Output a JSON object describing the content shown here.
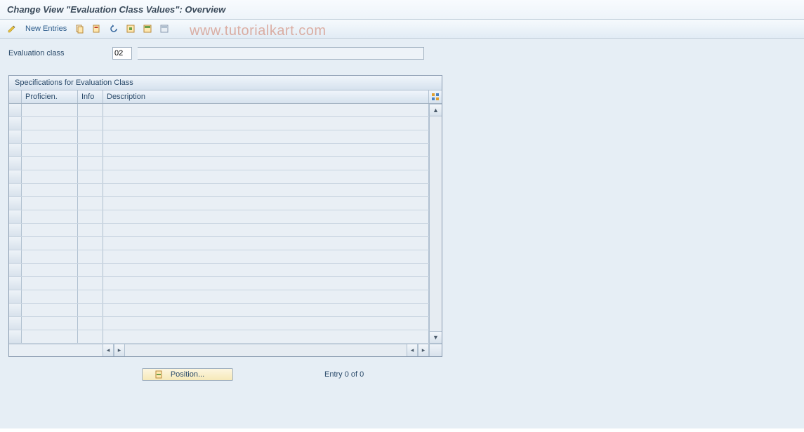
{
  "title": "Change View \"Evaluation Class Values\": Overview",
  "toolbar": {
    "new_entries_label": "New Entries",
    "icons": {
      "edit": "edit-pencil-icon",
      "copy": "copy-icon",
      "delete": "delete-icon",
      "undo": "undo-icon",
      "select_all": "select-all-icon",
      "select_block": "select-block-icon",
      "deselect": "deselect-icon"
    }
  },
  "watermark": "www.tutorialkart.com",
  "form": {
    "evaluation_class_label": "Evaluation class",
    "evaluation_class_value": "02",
    "evaluation_class_desc": ""
  },
  "table": {
    "title": "Specifications for Evaluation Class",
    "columns": {
      "proficiency": "Proficien.",
      "info": "Info",
      "description": "Description"
    },
    "rows": [
      {
        "proficiency": "",
        "info": "",
        "description": ""
      },
      {
        "proficiency": "",
        "info": "",
        "description": ""
      },
      {
        "proficiency": "",
        "info": "",
        "description": ""
      },
      {
        "proficiency": "",
        "info": "",
        "description": ""
      },
      {
        "proficiency": "",
        "info": "",
        "description": ""
      },
      {
        "proficiency": "",
        "info": "",
        "description": ""
      },
      {
        "proficiency": "",
        "info": "",
        "description": ""
      },
      {
        "proficiency": "",
        "info": "",
        "description": ""
      },
      {
        "proficiency": "",
        "info": "",
        "description": ""
      },
      {
        "proficiency": "",
        "info": "",
        "description": ""
      },
      {
        "proficiency": "",
        "info": "",
        "description": ""
      },
      {
        "proficiency": "",
        "info": "",
        "description": ""
      },
      {
        "proficiency": "",
        "info": "",
        "description": ""
      },
      {
        "proficiency": "",
        "info": "",
        "description": ""
      },
      {
        "proficiency": "",
        "info": "",
        "description": ""
      },
      {
        "proficiency": "",
        "info": "",
        "description": ""
      },
      {
        "proficiency": "",
        "info": "",
        "description": ""
      },
      {
        "proficiency": "",
        "info": "",
        "description": ""
      }
    ]
  },
  "footer": {
    "position_label": "Position...",
    "entry_text": "Entry 0 of 0"
  }
}
